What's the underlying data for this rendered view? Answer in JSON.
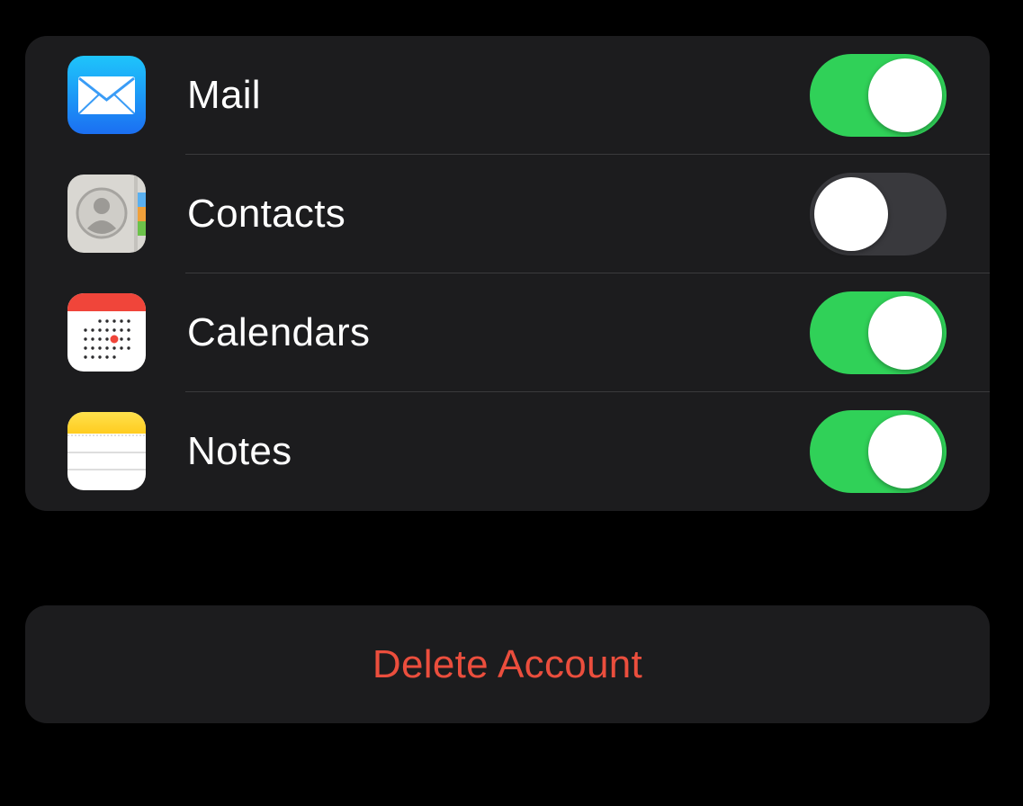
{
  "accent": {
    "switch_on": "#30d158",
    "switch_off": "#39393d",
    "destructive": "#eb4e3d"
  },
  "apps": [
    {
      "icon": "mail-app-icon",
      "label": "Mail",
      "enabled": true
    },
    {
      "icon": "contacts-app-icon",
      "label": "Contacts",
      "enabled": false
    },
    {
      "icon": "calendar-app-icon",
      "label": "Calendars",
      "enabled": true
    },
    {
      "icon": "notes-app-icon",
      "label": "Notes",
      "enabled": true
    }
  ],
  "delete_account": {
    "label": "Delete Account"
  }
}
